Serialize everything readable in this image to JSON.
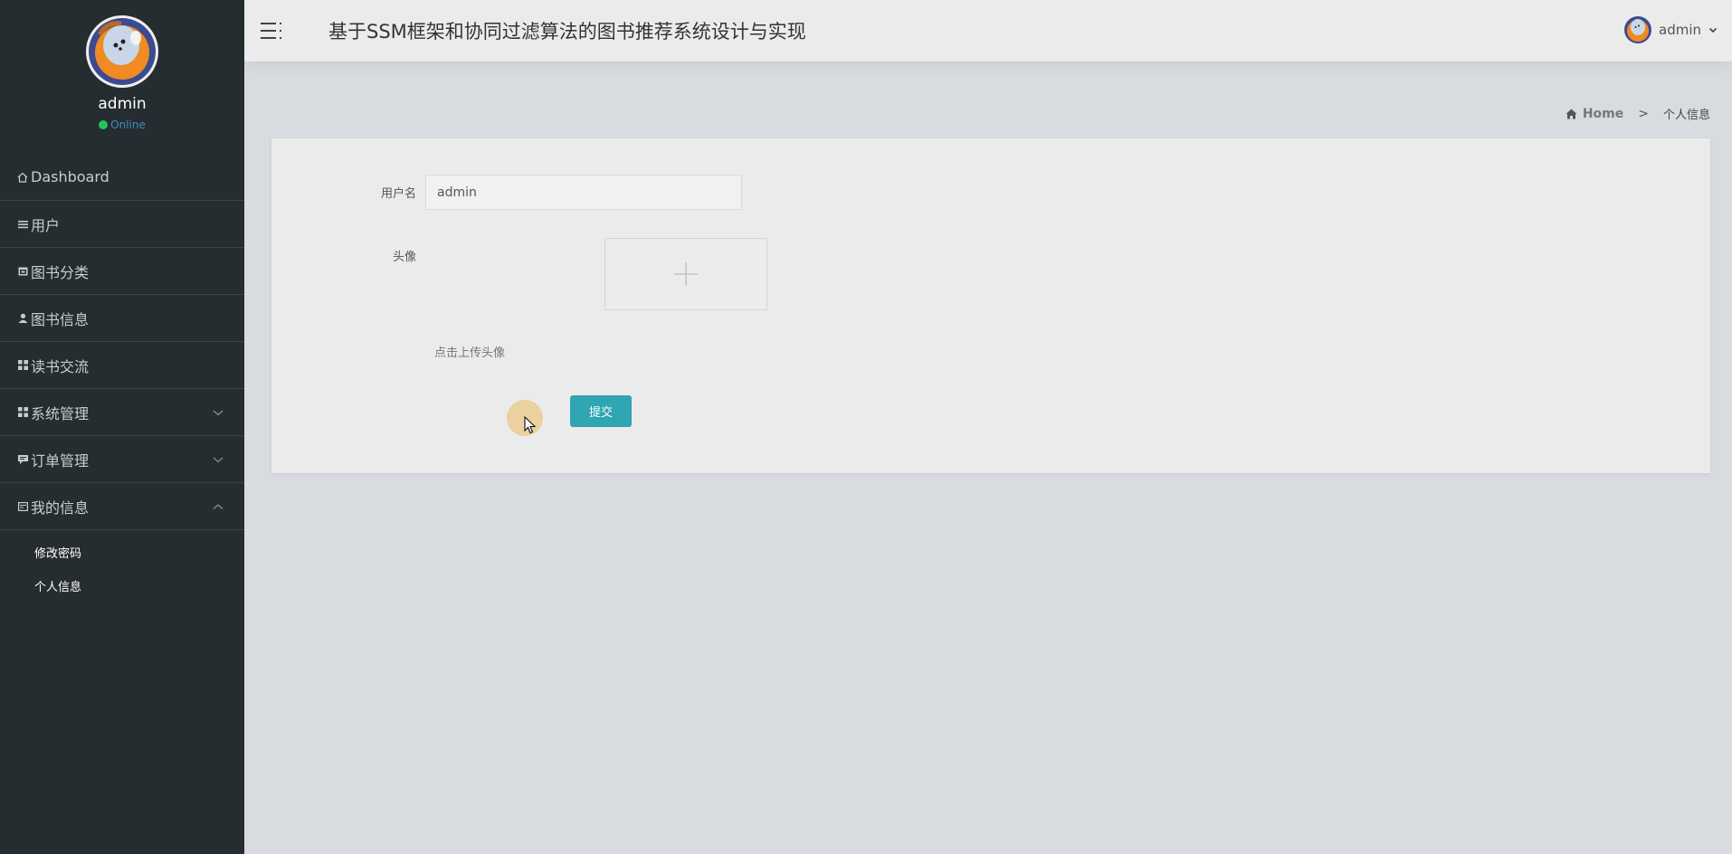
{
  "profile": {
    "name": "admin",
    "status": "Online"
  },
  "sidebar": {
    "items": [
      {
        "label": "Dashboard",
        "icon": "home-icon"
      },
      {
        "label": "用户",
        "icon": "list-icon"
      },
      {
        "label": "图书分类",
        "icon": "calendar-icon"
      },
      {
        "label": "图书信息",
        "icon": "user-icon"
      },
      {
        "label": "读书交流",
        "icon": "grid-icon"
      },
      {
        "label": "系统管理",
        "icon": "grid-icon",
        "expandable": true
      },
      {
        "label": "订单管理",
        "icon": "comment-icon",
        "expandable": true
      },
      {
        "label": "我的信息",
        "icon": "card-icon",
        "expanded": true
      }
    ],
    "submenu": [
      {
        "label": "修改密码"
      },
      {
        "label": "个人信息"
      }
    ]
  },
  "header": {
    "title": "基于SSM框架和协同过滤算法的图书推荐系统设计与实现",
    "user": "admin"
  },
  "breadcrumb": {
    "home": "Home",
    "separator": ">",
    "current": "个人信息"
  },
  "form": {
    "username_label": "用户名",
    "username_value": "admin",
    "avatar_label": "头像",
    "upload_hint": "点击上传头像",
    "submit_label": "提交"
  },
  "colors": {
    "sidebar_bg": "#262d30",
    "accent_button": "#2fa6b2",
    "status_online": "#22c55e",
    "link_blue": "#3c8dbc"
  }
}
